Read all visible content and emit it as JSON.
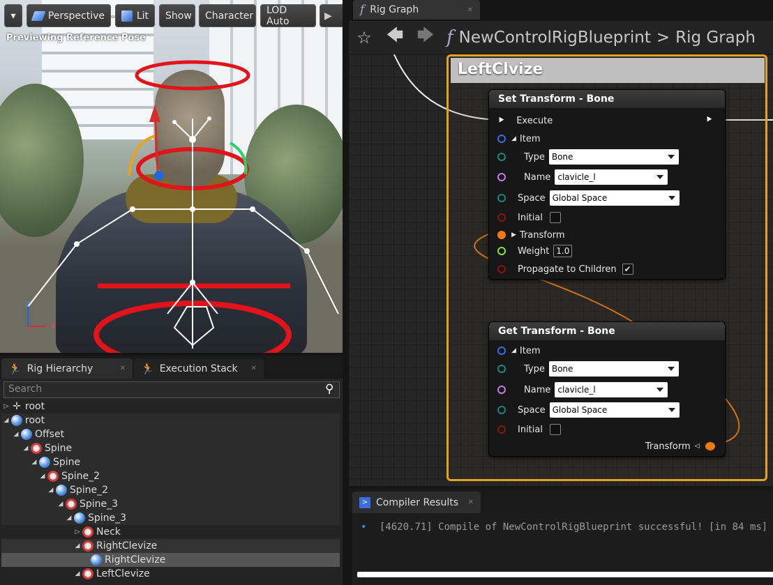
{
  "viewport": {
    "toolbar": {
      "menu": "▾",
      "perspective": "Perspective",
      "lit": "Lit",
      "show": "Show",
      "character": "Character",
      "lod": "LOD Auto"
    },
    "status": "Previewing Reference Pose",
    "axes": {
      "z": "Z",
      "x": "X"
    }
  },
  "graph_tab": {
    "label": "Rig Graph"
  },
  "graph": {
    "breadcrumb": [
      "NewControlRigBlueprint",
      "Rig Graph"
    ],
    "separator": ">",
    "comment_title": "LeftClvize",
    "set_node": {
      "title": "Set Transform - Bone",
      "execute": "Execute",
      "item": "Item",
      "type_label": "Type",
      "type_value": "Bone",
      "name_label": "Name",
      "name_value": "clavicle_l",
      "space_label": "Space",
      "space_value": "Global Space",
      "initial_label": "Initial",
      "transform_label": "Transform",
      "weight_label": "Weight",
      "weight_value": "1.0",
      "propagate_label": "Propagate to Children"
    },
    "get_node": {
      "title": "Get Transform - Bone",
      "item": "Item",
      "type_label": "Type",
      "type_value": "Bone",
      "name_label": "Name",
      "name_value": "clavicle_l",
      "space_label": "Space",
      "space_value": "Global Space",
      "initial_label": "Initial",
      "transform_label": "Transform"
    }
  },
  "panel_tabs": {
    "hierarchy": "Rig Hierarchy",
    "execution": "Execution Stack"
  },
  "hierarchy": {
    "search_placeholder": "Search",
    "rows": [
      {
        "label": "root"
      },
      {
        "label": "root"
      },
      {
        "label": "Offset"
      },
      {
        "label": "Spine"
      },
      {
        "label": "Spine"
      },
      {
        "label": "Spine_2"
      },
      {
        "label": "Spine_2"
      },
      {
        "label": "Spine_3"
      },
      {
        "label": "Spine_3"
      },
      {
        "label": "Neck"
      },
      {
        "label": "RightClevize"
      },
      {
        "label": "RightClevize"
      },
      {
        "label": "LeftClevize"
      }
    ]
  },
  "compiler": {
    "tab": "Compiler Results",
    "bullet": "•",
    "message": "[4620.71] Compile of NewControlRigBlueprint successful! [in 84 ms]"
  },
  "colors": {
    "accent": "#e8a21c",
    "exec": "#ffffff",
    "transform_pin": "#f07a12"
  }
}
